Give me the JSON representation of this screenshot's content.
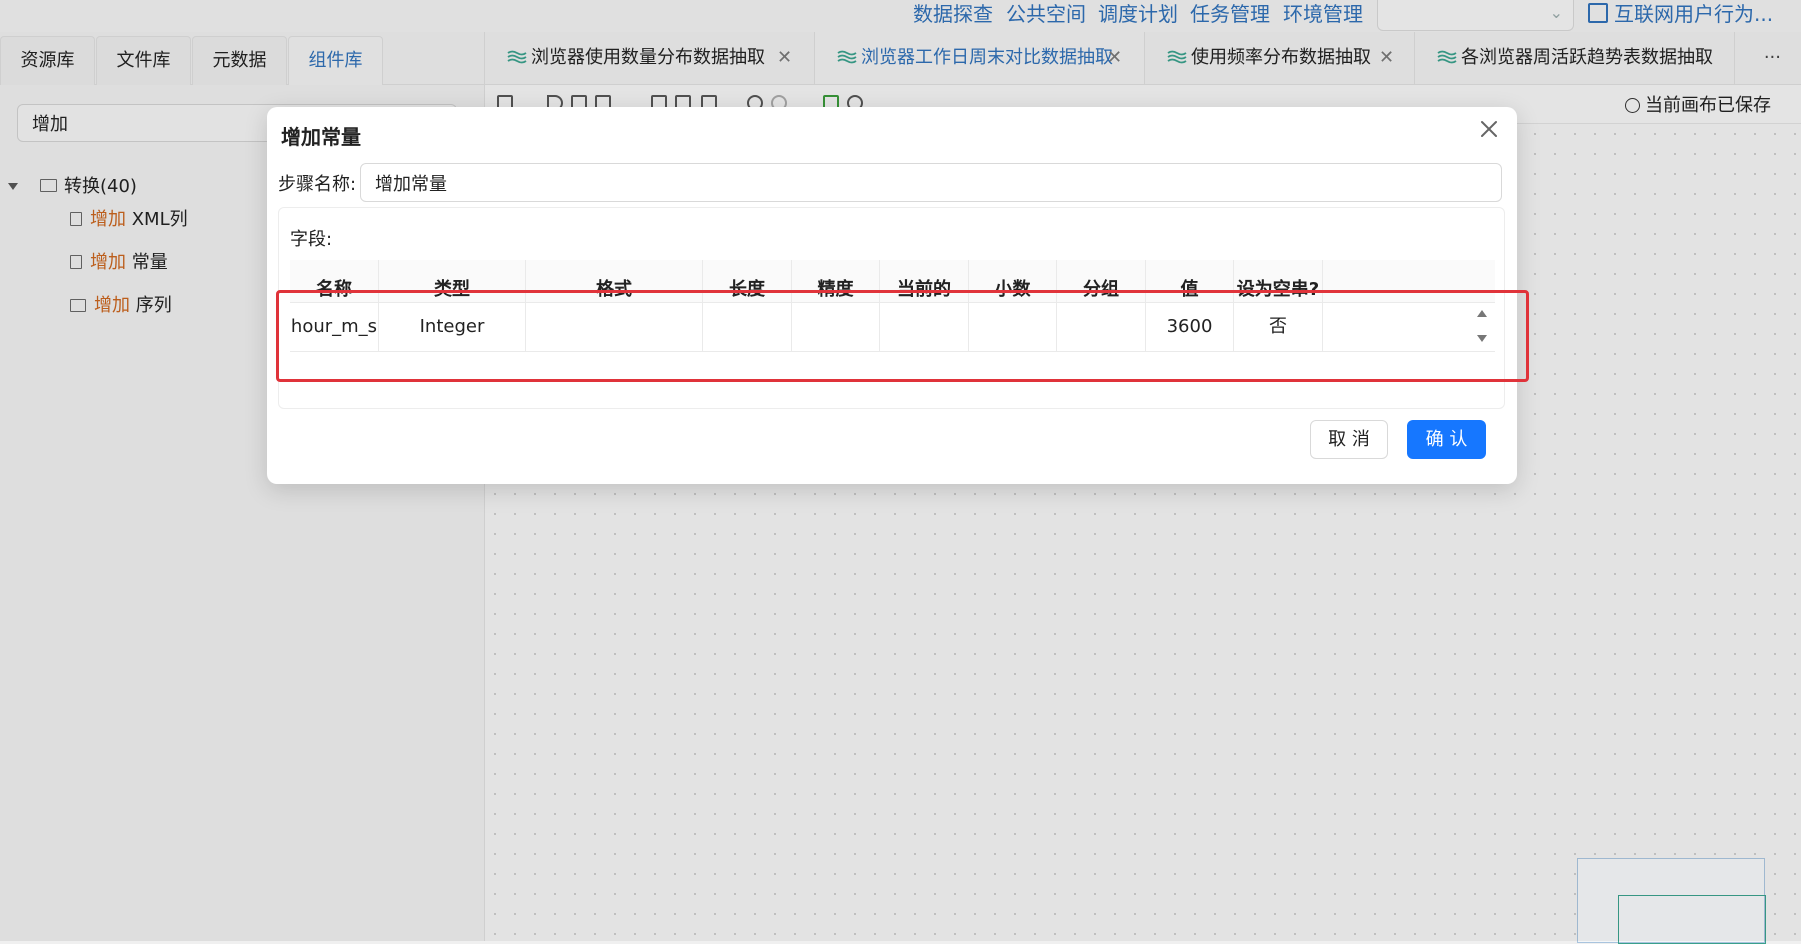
{
  "topnav": {
    "links": [
      "数据探查",
      "公共空间",
      "调度计划",
      "任务管理",
      "环境管理"
    ],
    "project": "互联网用户行为..."
  },
  "left_panel": {
    "tabs": [
      "资源库",
      "文件库",
      "元数据",
      "组件库"
    ],
    "active_tab": "组件库",
    "search_value": "增加",
    "tree": {
      "root": "转换(40)",
      "items": [
        {
          "highlight": "增加",
          "rest": " XML列"
        },
        {
          "highlight": "增加",
          "rest": " 常量"
        },
        {
          "highlight": "增加",
          "rest": " 序列"
        }
      ]
    }
  },
  "editor": {
    "tabs": [
      "浏览器使用数量分布数据抽取",
      "浏览器工作日周末对比数据抽取",
      "使用频率分布数据抽取",
      "各浏览器周活跃趋势表数据抽取"
    ],
    "active_tab_index": 1,
    "more": "···",
    "saved_status": "当前画布已保存"
  },
  "modal": {
    "title": "增加常量",
    "step_name_label": "步骤名称:",
    "step_name_value": "增加常量",
    "fields_label": "字段:",
    "columns": [
      "名称",
      "类型",
      "格式",
      "长度",
      "精度",
      "当前的",
      "小数",
      "分组",
      "值",
      "设为空串?"
    ],
    "rows": [
      [
        "hour_m_s",
        "Integer",
        "",
        "",
        "",
        "",
        "",
        "",
        "3600",
        "否"
      ]
    ],
    "cancel_label": "取 消",
    "confirm_label": "确 认"
  },
  "colors": {
    "accent": "#1677ff",
    "link": "#2f6fb6",
    "highlight_box": "#e0333a",
    "tree_match": "#c8641e"
  }
}
